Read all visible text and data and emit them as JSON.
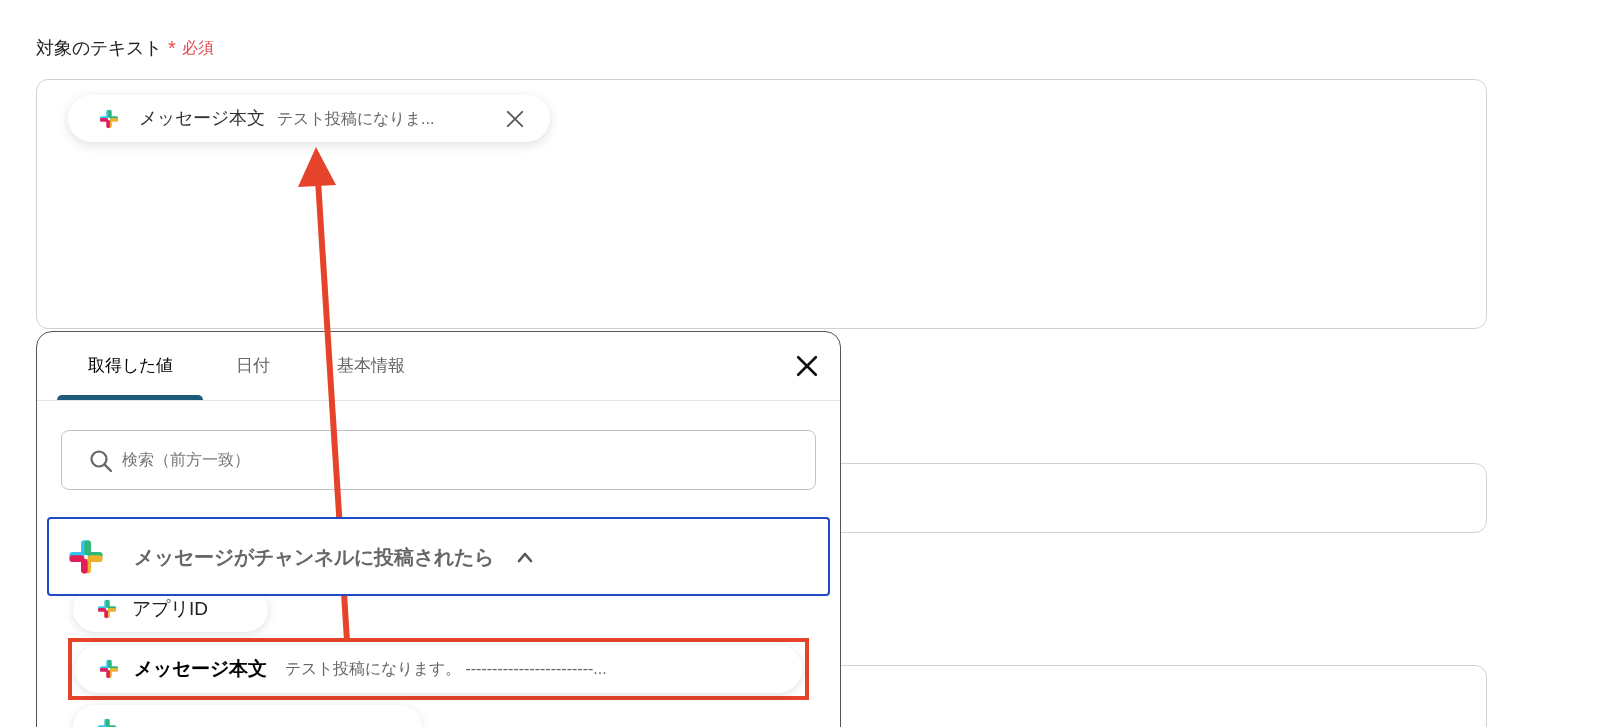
{
  "field": {
    "label": "対象のテキスト",
    "required_mark": "*",
    "required_text": "必須",
    "chips": [
      {
        "name": "メッセージ本文",
        "value": "テスト投稿になりま..."
      }
    ]
  },
  "popup": {
    "tabs": [
      {
        "label": "取得した値",
        "selected": true
      },
      {
        "label": "日付",
        "selected": false
      },
      {
        "label": "基本情報",
        "selected": false
      }
    ],
    "search": {
      "placeholder": "検索（前方一致）"
    },
    "group": {
      "title": "メッセージがチャンネルに投稿されたら",
      "expanded": true
    },
    "items": [
      {
        "name": "アプリID",
        "highlighted": false
      },
      {
        "name": "メッセージ本文",
        "value": "テスト投稿になります。 ------------------------...",
        "highlighted": true
      }
    ]
  }
}
